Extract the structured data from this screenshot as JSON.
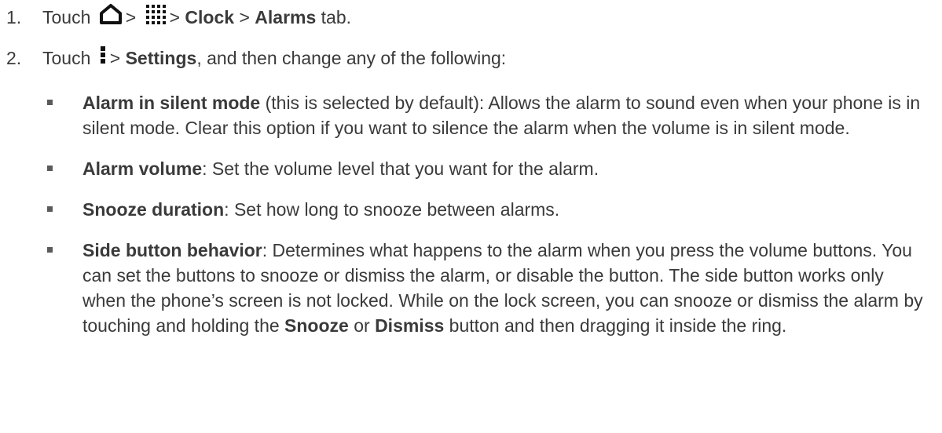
{
  "steps": [
    {
      "num": "1.",
      "prefix": "Touch",
      "sep1": ">",
      "sep2": ">",
      "clock": "Clock",
      "sep3": ">",
      "alarms": "Alarms",
      "suffix": "tab."
    },
    {
      "num": "2.",
      "prefix": "Touch",
      "sep1": ">",
      "settings": "Settings",
      "suffix": ", and then change any of the following:"
    }
  ],
  "icons": {
    "home": "home-icon",
    "apps": "apps-grid-icon",
    "menu": "overflow-menu-icon"
  },
  "bullets": [
    {
      "title": "Alarm in silent mode",
      "text": " (this is selected by default): Allows the alarm to sound even when your phone is in silent mode. Clear this option if you want to silence the alarm when the volume is in silent mode."
    },
    {
      "title": "Alarm volume",
      "text": ": Set the volume level that you want for the alarm."
    },
    {
      "title": "Snooze duration",
      "text": ": Set how long to snooze between alarms."
    },
    {
      "title": "Side button behavior",
      "text": ": Determines what happens to the alarm when you press the volume buttons. You can set the buttons to snooze or dismiss the alarm, or disable the button. The side button works only when the phone’s screen is not locked. While on the lock screen, you can snooze or dismiss the alarm by touching and holding the ",
      "snooze": "Snooze",
      "or": " or ",
      "dismiss": "Dismiss",
      "end": " button and then dragging it inside the ring."
    }
  ]
}
